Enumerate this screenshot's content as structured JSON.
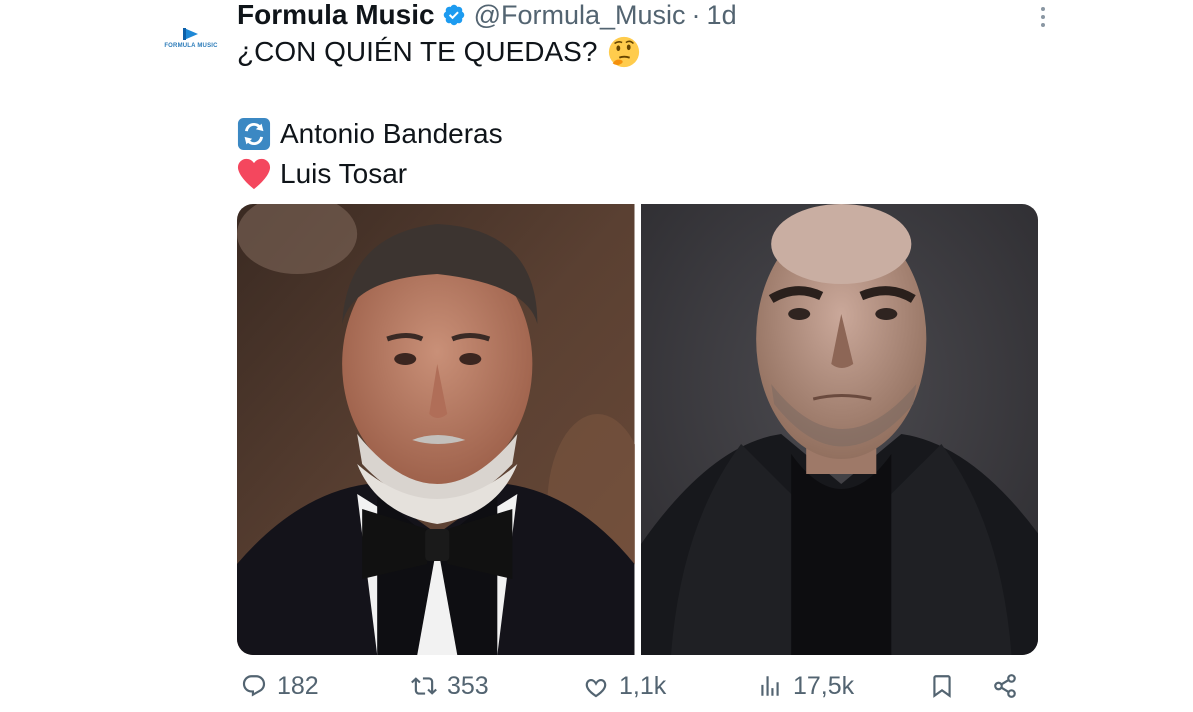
{
  "author": {
    "avatar_text": "FORMULA MUSIC",
    "display_name": "Formula Music",
    "handle": "@Formula_Music",
    "separator": "·",
    "time": "1d",
    "verified_color": "#1d9bf0"
  },
  "tweet": {
    "line1": "¿CON QUIÉN TE QUEDAS?",
    "line1_emoji": "thinking-face-icon",
    "line2": "Antonio Banderas",
    "line2_emoji": "repeat-button-icon",
    "line3": "Luis Tosar",
    "line3_emoji": "red-heart-icon"
  },
  "media": {
    "images": [
      "antonio-banderas-photo",
      "luis-tosar-photo"
    ]
  },
  "actions": {
    "replies": "182",
    "retweets": "353",
    "likes": "1,1k",
    "views": "17,5k"
  },
  "colors": {
    "text": "#0f1419",
    "secondary": "#536471",
    "accent": "#1d9bf0"
  }
}
